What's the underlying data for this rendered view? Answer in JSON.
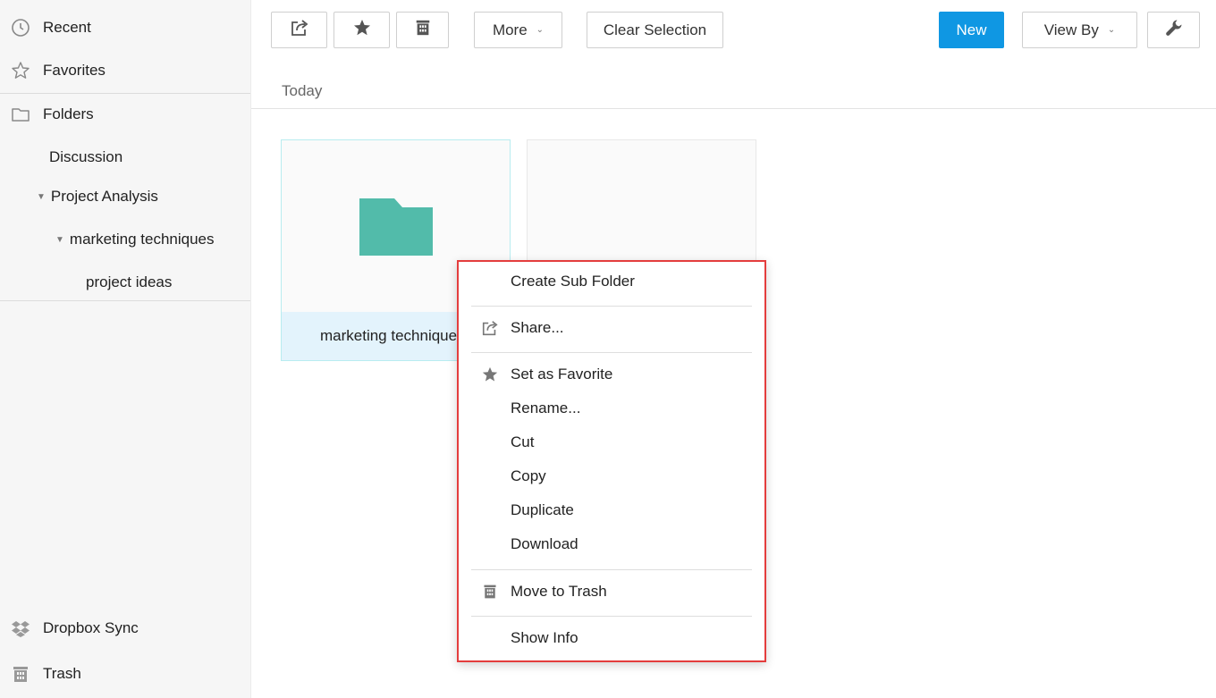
{
  "sidebar": {
    "recent": "Recent",
    "favorites": "Favorites",
    "folders": "Folders",
    "tree": [
      {
        "label": "Discussion"
      },
      {
        "label": "Project Analysis"
      },
      {
        "label": "marketing techniques"
      },
      {
        "label": "project ideas"
      }
    ],
    "dropbox": "Dropbox Sync",
    "trash": "Trash"
  },
  "toolbar": {
    "more": "More",
    "clear_selection": "Clear Selection",
    "new": "New",
    "view_by": "View By"
  },
  "section": {
    "label": "Today"
  },
  "files": [
    {
      "name": "marketing techniques"
    }
  ],
  "context_menu": {
    "items": [
      {
        "label": "Create Sub Folder"
      },
      {
        "label": "Share..."
      },
      {
        "label": "Set as Favorite"
      },
      {
        "label": "Rename..."
      },
      {
        "label": "Cut"
      },
      {
        "label": "Copy"
      },
      {
        "label": "Duplicate"
      },
      {
        "label": "Download"
      },
      {
        "label": "Move to Trash"
      },
      {
        "label": "Show Info"
      }
    ]
  },
  "colors": {
    "accent": "#0f97e3",
    "folder": "#52bbaa",
    "highlight_border": "#e43d3d",
    "selection": "#e3f3fc"
  }
}
